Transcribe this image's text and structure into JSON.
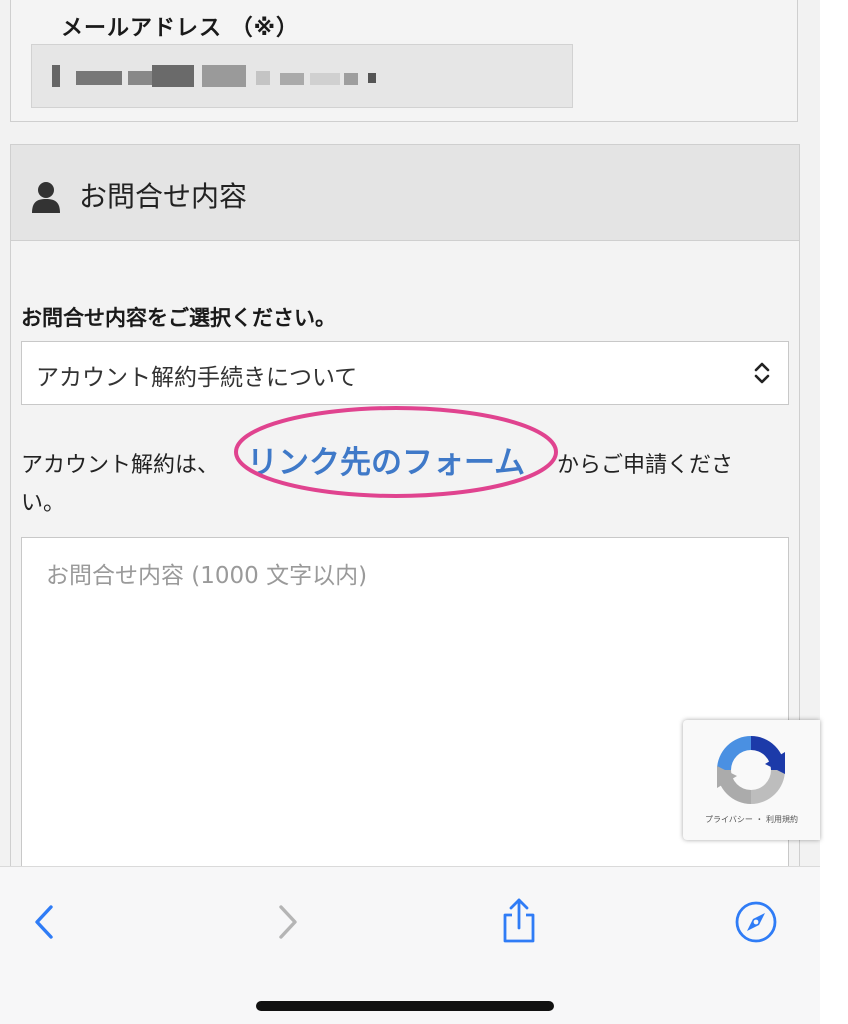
{
  "email_section": {
    "label": "メールアドレス （※）"
  },
  "inquiry_section": {
    "title": "お問合せ内容",
    "select_label": "お問合せ内容をご選択ください。",
    "select_value": "アカウント解約手続きについて",
    "note_prefix": "アカウント解約は、",
    "note_link": "リンク先のフォーム",
    "note_suffix": "からご申請くださ",
    "note_line2": "い。",
    "textarea_placeholder": "お問合せ内容 (1000 文字以内)"
  },
  "recaptcha": {
    "footer_text": "プライバシー ・ 利用規約"
  },
  "toolbar": {
    "back": "back-chevron",
    "forward": "forward-chevron",
    "share": "share-icon",
    "compass": "compass-icon"
  },
  "colors": {
    "link": "#3f79c8",
    "highlight": "#e0438f",
    "ios_blue": "#2f7cf6",
    "disabled": "#b5b5b5"
  }
}
